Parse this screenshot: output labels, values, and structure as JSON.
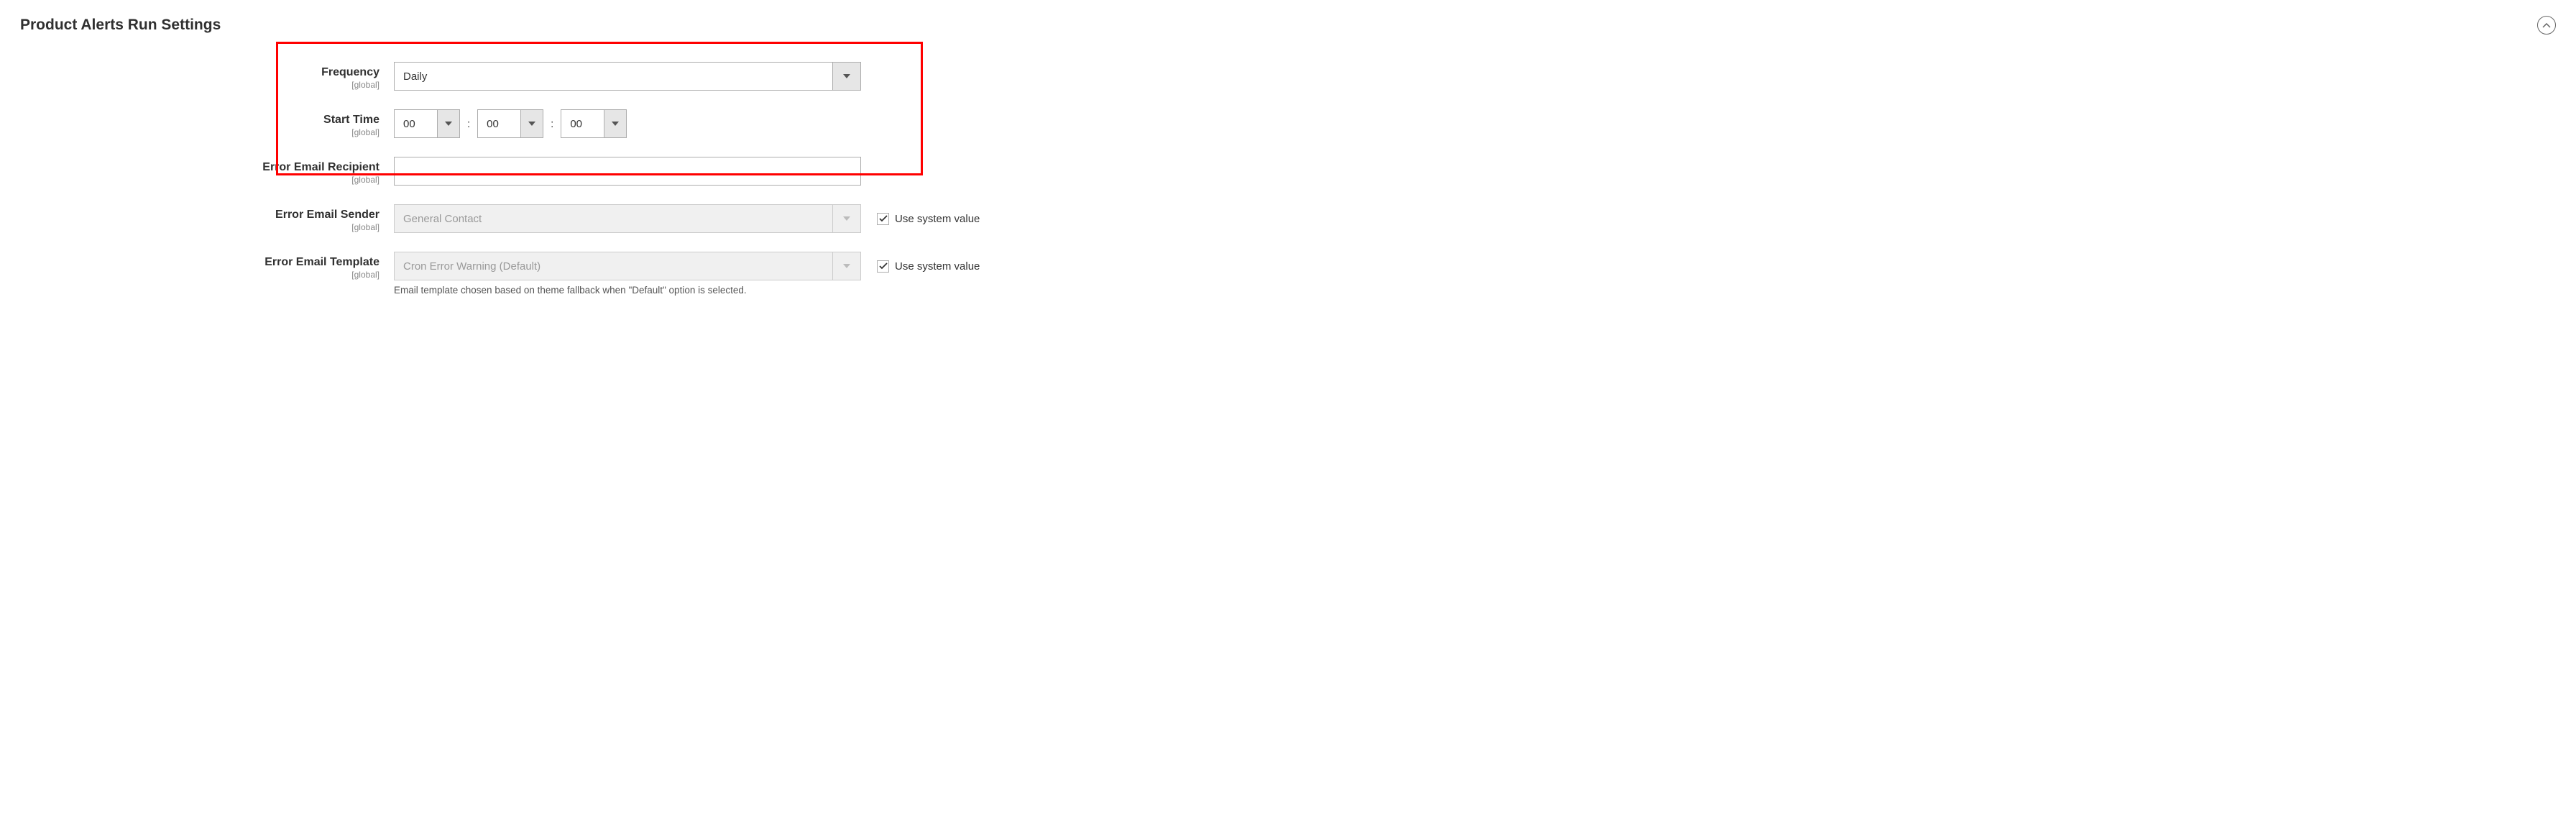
{
  "section": {
    "title": "Product Alerts Run Settings"
  },
  "fields": {
    "frequency": {
      "label": "Frequency",
      "scope": "[global]",
      "value": "Daily"
    },
    "start_time": {
      "label": "Start Time",
      "scope": "[global]",
      "hours": "00",
      "minutes": "00",
      "seconds": "00",
      "sep": ":"
    },
    "error_recipient": {
      "label": "Error Email Recipient",
      "scope": "[global]",
      "value": ""
    },
    "error_sender": {
      "label": "Error Email Sender",
      "scope": "[global]",
      "value": "General Contact",
      "use_system_label": "Use system value",
      "use_system_checked": true
    },
    "error_template": {
      "label": "Error Email Template",
      "scope": "[global]",
      "value": "Cron Error Warning (Default)",
      "use_system_label": "Use system value",
      "use_system_checked": true,
      "hint": "Email template chosen based on theme fallback when \"Default\" option is selected."
    }
  }
}
